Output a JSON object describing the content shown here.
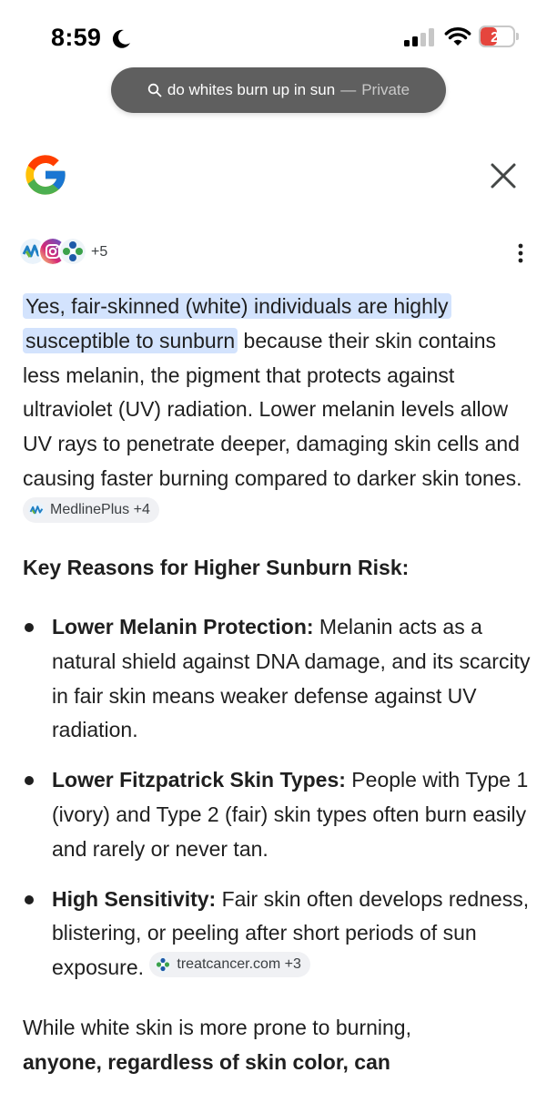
{
  "status_bar": {
    "time": "8:59",
    "battery_level": "20",
    "battery_fraction": 0.2,
    "icons": [
      "moon-icon",
      "cellular-signal-icon",
      "wifi-icon",
      "battery-icon"
    ]
  },
  "url_bar": {
    "query": "do whites burn up in sun",
    "separator": "—",
    "mode": "Private"
  },
  "header": {
    "logo": "google-g-icon",
    "close": "close-icon"
  },
  "sources": {
    "count_label": "+5",
    "icons": [
      "medlineplus-icon",
      "instagram-icon",
      "treatcancer-icon"
    ]
  },
  "answer": {
    "highlight_1": "Yes, fair-skinned (white) individuals are highly",
    "highlight_2": "susceptible to sunburn",
    "body": " because their skin contains less melanin, the pigment that protects against ultraviolet (UV) radiation. Lower melanin levels allow UV rays to penetrate deeper, damaging skin cells and causing faster burning compared to darker skin tones. ",
    "citation": "MedlinePlus +4"
  },
  "section_title": "Key Reasons for Higher Sunburn Risk:",
  "reasons": [
    {
      "term": "Lower Melanin Protection:",
      "text": " Melanin acts as a natural shield against DNA damage, and its scarcity in fair skin means weaker defense against UV radiation."
    },
    {
      "term": "Lower Fitzpatrick Skin Types:",
      "text": " People with Type 1 (ivory) and Type 2 (fair) skin types often burn easily and rarely or never tan."
    },
    {
      "term": "High Sensitivity:",
      "text": " Fair skin often develops redness, blistering, or peeling after short periods of sun exposure. ",
      "citation": "treatcancer.com +3"
    }
  ],
  "closing": {
    "text": "While white skin is more prone to burning,",
    "bold": "anyone, regardless of skin color, can"
  },
  "colors": {
    "highlight": "#d3e3fd",
    "chip_bg": "#f0f1f4",
    "url_pill": "#5f5f5f",
    "battery_red": "#e5453d"
  }
}
